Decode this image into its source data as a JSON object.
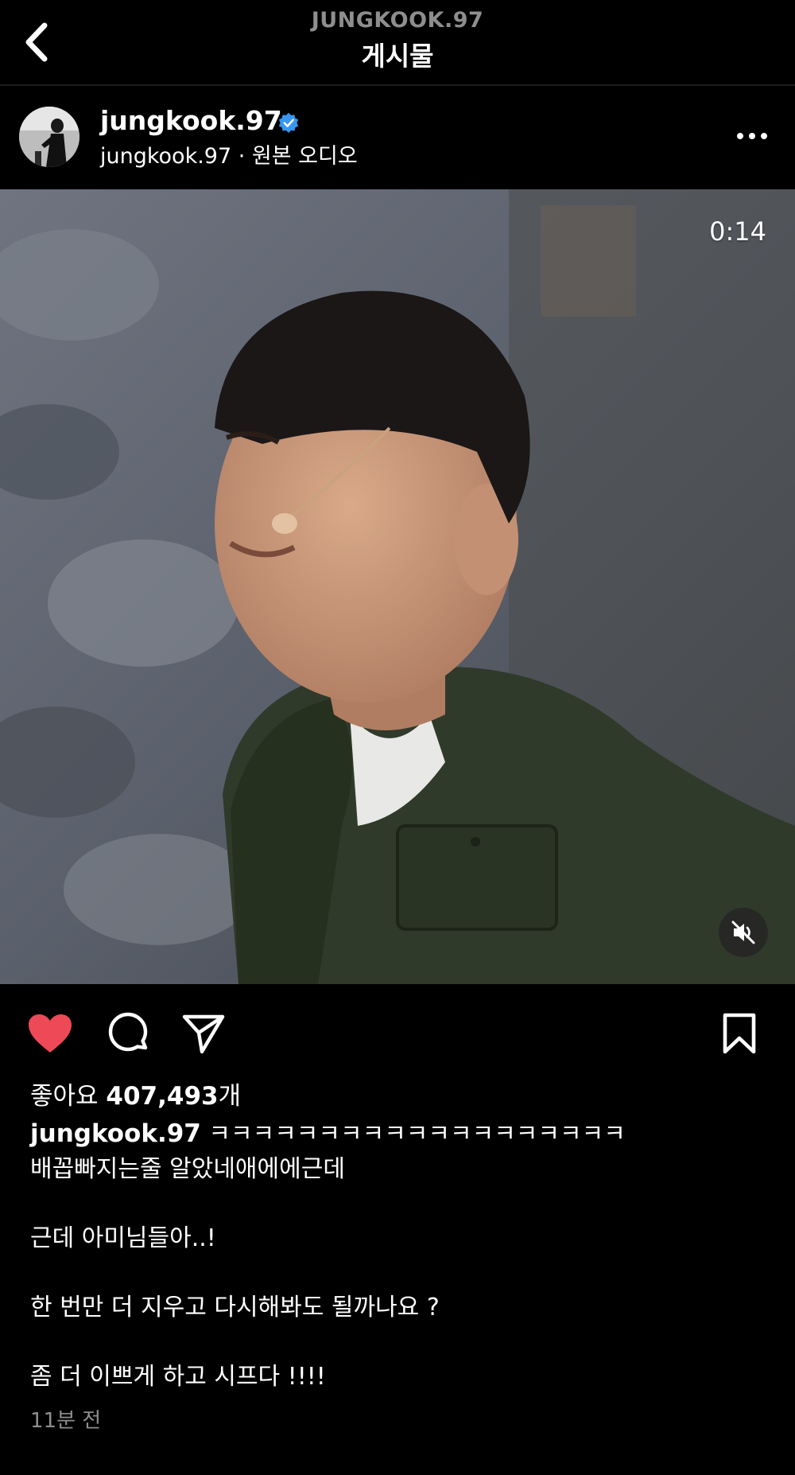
{
  "header": {
    "username": "JUNGKOOK.97",
    "title": "게시물"
  },
  "post": {
    "author": "jungkook.97",
    "verified": true,
    "audio": "jungkook.97 · 원본 오디오",
    "video": {
      "timer": "0:14",
      "muted": true
    },
    "likes": {
      "prefix": "좋아요",
      "count": "407,493",
      "suffix": "개"
    },
    "liked": true,
    "caption": {
      "username": "jungkook.97",
      "first_line": " ㅋㅋㅋㅋㅋㅋㅋㅋㅋㅋㅋㅋㅋㅋㅋㅋㅋㅋㅋ",
      "lines": [
        "배꼽빠지는줄 알았네애에에근데",
        "",
        "근데 아미님들아..!",
        "",
        "한 번만 더 지우고 다시해봐도 될까나요 ?",
        "",
        "좀 더 이쁘게 하고 시프다 !!!!"
      ]
    },
    "timestamp": "11분 전"
  },
  "colors": {
    "background": "#000000",
    "like_red": "#ed4956",
    "verified_blue": "#3897f0",
    "muted_text": "#8e8e8e"
  },
  "icons": {
    "back": "chevron-left-icon",
    "verified": "verified-badge-icon",
    "more": "more-horizontal-icon",
    "mute": "speaker-muted-icon",
    "like": "heart-filled-icon",
    "comment": "comment-bubble-icon",
    "share": "paper-plane-icon",
    "save": "bookmark-icon"
  }
}
